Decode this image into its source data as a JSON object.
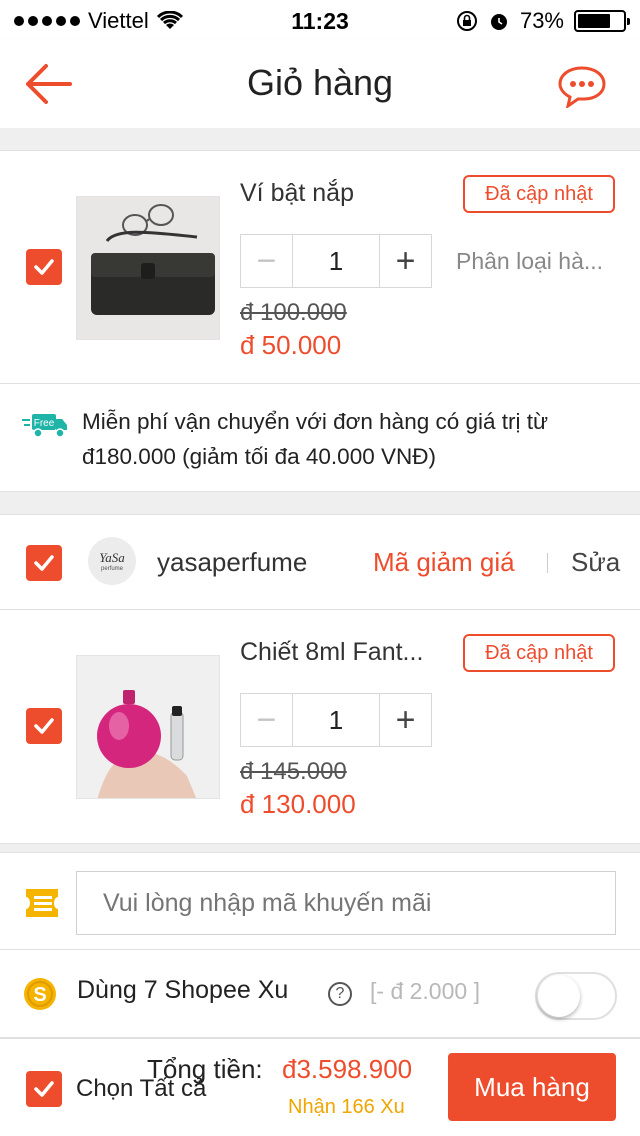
{
  "status_bar": {
    "carrier": "Viettel",
    "time": "11:23",
    "battery": "73%",
    "battery_level": 0.73
  },
  "header": {
    "title": "Giỏ hàng",
    "back_icon": "back-arrow-icon",
    "chat_icon": "chat-icon"
  },
  "cart_items": [
    {
      "name": "Ví bật nắp",
      "badge": "Đã cập nhật",
      "quantity": "1",
      "minus": "−",
      "plus": "+",
      "variation": "Phân loại hà...",
      "old_price": "đ 100.000",
      "new_price": "đ 50.000",
      "checked": true
    },
    {
      "name": "Chiết 8ml Fant...",
      "badge": "Đã cập nhật",
      "quantity": "1",
      "minus": "−",
      "plus": "+",
      "old_price": "đ 145.000",
      "new_price": "đ 130.000",
      "checked": true
    }
  ],
  "shipping": {
    "badge": "Free",
    "text": "Miễn phí vận chuyển với đơn hàng có giá trị từ đ180.000 (giảm tối đa 40.000 VNĐ)"
  },
  "shop": {
    "name": "yasaperfume",
    "logo_text": "YaSa",
    "logo_sub": "perfume",
    "voucher_label": "Mã giảm giá",
    "edit_label": "Sửa"
  },
  "promo": {
    "placeholder": "Vui lòng nhập mã khuyến mãi"
  },
  "coins": {
    "label": "Dùng 7 Shopee Xu",
    "help": "?",
    "discount": "[- đ 2.000 ]",
    "enabled": false
  },
  "footer": {
    "select_all": "Chọn Tất cả",
    "total_label": "Tổng tiền:",
    "total_value": "đ3.598.900",
    "earn_coins": "Nhận 166 Xu",
    "buy_label": "Mua hàng"
  },
  "colors": {
    "accent": "#ee4d2d",
    "coin_gold": "#f0a500",
    "ship_teal": "#1fb4a8"
  }
}
